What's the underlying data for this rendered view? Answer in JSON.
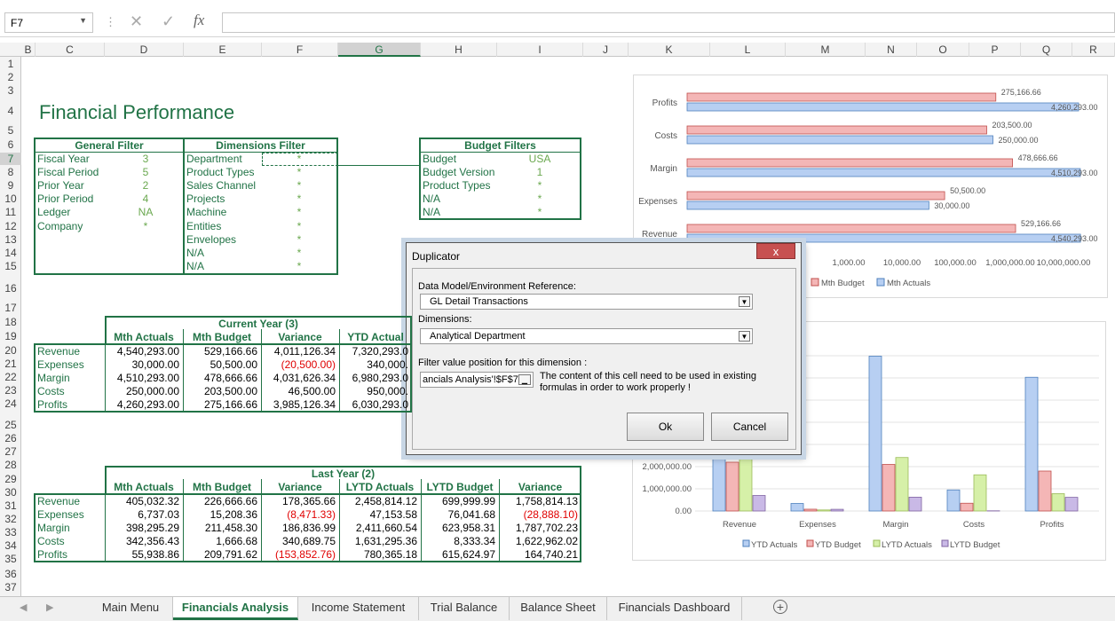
{
  "namebox": "F7",
  "fx_label": "fx",
  "columns": [
    "B",
    "C",
    "D",
    "E",
    "F",
    "G",
    "H",
    "I",
    "J",
    "K",
    "L",
    "M",
    "N",
    "O",
    "P",
    "Q",
    "R"
  ],
  "rows": [
    "1",
    "2",
    "3",
    "4",
    "5",
    "6",
    "7",
    "8",
    "9",
    "10",
    "11",
    "12",
    "13",
    "14",
    "15",
    "16",
    "17",
    "18",
    "19",
    "20",
    "21",
    "22",
    "23",
    "24",
    "25",
    "26",
    "27",
    "28",
    "29",
    "30",
    "31",
    "32",
    "33",
    "34",
    "35",
    "36",
    "37"
  ],
  "title": "Financial Performance",
  "general_filter": {
    "header": "General Filter",
    "items": [
      [
        "Fiscal Year",
        "3"
      ],
      [
        "Fiscal Period",
        "5"
      ],
      [
        "Prior Year",
        "2"
      ],
      [
        "Prior Period",
        "4"
      ],
      [
        "Ledger",
        "NA"
      ],
      [
        "Company",
        "*"
      ]
    ]
  },
  "dimensions_filter": {
    "header": "Dimensions Filter",
    "items": [
      [
        "Department",
        "*"
      ],
      [
        "Product Types",
        "*"
      ],
      [
        "Sales Channel",
        "*"
      ],
      [
        "Projects",
        "*"
      ],
      [
        "Machine",
        "*"
      ],
      [
        "Entities",
        "*"
      ],
      [
        "Envelopes",
        "*"
      ],
      [
        "N/A",
        "*"
      ],
      [
        "N/A",
        "*"
      ]
    ]
  },
  "budget_filters": {
    "header": "Budget Filters",
    "items": [
      [
        "Budget",
        "USA"
      ],
      [
        "Budget Version",
        "1"
      ],
      [
        "Product Types",
        "*"
      ],
      [
        "N/A",
        "*"
      ],
      [
        "N/A",
        "*"
      ]
    ]
  },
  "current_year": {
    "header": "Current Year (3)",
    "cols": [
      "Mth Actuals",
      "Mth Budget",
      "Variance",
      "YTD Actual"
    ],
    "rows": [
      [
        "Revenue",
        "4,540,293.00",
        "529,166.66",
        "4,011,126.34",
        "7,320,293.0"
      ],
      [
        "Expenses",
        "30,000.00",
        "50,500.00",
        "(20,500.00)",
        "340,000."
      ],
      [
        "Margin",
        "4,510,293.00",
        "478,666.66",
        "4,031,626.34",
        "6,980,293.0"
      ],
      [
        "Costs",
        "250,000.00",
        "203,500.00",
        "46,500.00",
        "950,000."
      ],
      [
        "Profits",
        "4,260,293.00",
        "275,166.66",
        "3,985,126.34",
        "6,030,293.0"
      ]
    ]
  },
  "last_year": {
    "header": "Last Year (2)",
    "cols": [
      "Mth Actuals",
      "Mth Budget",
      "Variance",
      "LYTD Actuals",
      "LYTD Budget",
      "Variance"
    ],
    "rows": [
      [
        "Revenue",
        "405,032.32",
        "226,666.66",
        "178,365.66",
        "2,458,814.12",
        "699,999.99",
        "1,758,814.13"
      ],
      [
        "Expenses",
        "6,737.03",
        "15,208.36",
        "(8,471.33)",
        "47,153.58",
        "76,041.68",
        "(28,888.10)"
      ],
      [
        "Margin",
        "398,295.29",
        "211,458.30",
        "186,836.99",
        "2,411,660.54",
        "623,958.31",
        "1,787,702.23"
      ],
      [
        "Costs",
        "342,356.43",
        "1,666.68",
        "340,689.75",
        "1,631,295.36",
        "8,333.34",
        "1,622,962.02"
      ],
      [
        "Profits",
        "55,938.86",
        "209,791.62",
        "(153,852.76)",
        "780,365.18",
        "615,624.97",
        "164,740.21"
      ]
    ]
  },
  "chart1": {
    "categories": [
      "Profits",
      "Costs",
      "Margin",
      "Expenses",
      "Revenue"
    ],
    "budget": [
      275166.66,
      203500,
      478666.66,
      50500,
      529166.66
    ],
    "actuals": [
      4260293,
      250000,
      4510293,
      30000,
      4540293
    ],
    "budget_labels": [
      "275,166.66",
      "203,500.00",
      "478,666.66",
      "50,500.00",
      "529,166.66"
    ],
    "actual_labels": [
      "4,260,293.00",
      "250,000.00",
      "4,510,293.00",
      "30,000.00",
      "4,540,293.00"
    ],
    "ticks": [
      "1,000.00",
      "10,000.00",
      "100,000.00",
      "1,000,000.00",
      "10,000,000.00"
    ],
    "legend": [
      "Mth Budget",
      "Mth Actuals"
    ],
    "colors": {
      "budget": "#f4b6b6",
      "actuals": "#b7cff2"
    }
  },
  "chart2": {
    "categories": [
      "Revenue",
      "Expenses",
      "Margin",
      "Costs",
      "Profits"
    ],
    "ticks": [
      "2,000,000.00",
      "1,000,000.00",
      "0.00"
    ],
    "legend": [
      "YTD Actuals",
      "YTD Budget",
      "LYTD Actuals",
      "LYTD Budget"
    ],
    "series": [
      {
        "name": "YTD Actuals",
        "values": [
          7320293,
          340000,
          6980293,
          950000,
          6030293
        ]
      },
      {
        "name": "YTD Budget",
        "values": [
          2200000,
          80000,
          2100000,
          350000,
          1800000
        ]
      },
      {
        "name": "LYTD Actuals",
        "values": [
          2458814.12,
          47153.58,
          2411660.54,
          1631295.36,
          780365.18
        ]
      },
      {
        "name": "LYTD Budget",
        "values": [
          699999.99,
          76041.68,
          623958.31,
          8333.34,
          615624.97
        ]
      }
    ],
    "colors": [
      "#b7cff2",
      "#f4b6b6",
      "#d6f0a8",
      "#c9b9e6"
    ]
  },
  "dialog": {
    "title": "Duplicator",
    "close": "x",
    "model_label": "Data Model/Environment Reference:",
    "model_value": "GL Detail Transactions",
    "dims_label": "Dimensions:",
    "dims_value": "Analytical Department",
    "filter_label": "Filter value position for this dimension :",
    "filter_value": "ancials Analysis'!$F$7",
    "note": "The content of this cell need to be used in existing formulas in order to work properly !",
    "ok": "Ok",
    "cancel": "Cancel"
  },
  "tabs": [
    "Main Menu",
    "Financials Analysis",
    "Income Statement",
    "Trial Balance",
    "Balance Sheet",
    "Financials Dashboard"
  ],
  "add_sheet": "+"
}
